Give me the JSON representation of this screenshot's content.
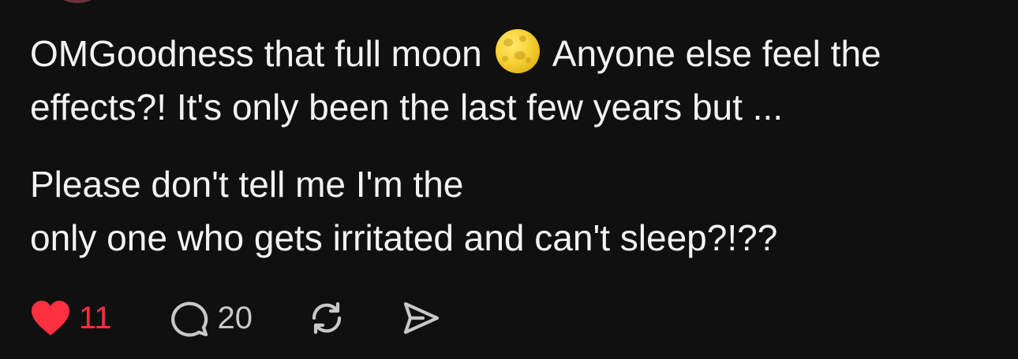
{
  "post": {
    "paragraph1": {
      "line1_before": "OMGoodness that full moon",
      "emoji": "full-moon-emoji",
      "line1_after": "Anyone else feel the",
      "line2": "effects?! It's only been the last few years but ..."
    },
    "paragraph2": {
      "line1": "Please don't tell me I'm the",
      "line2": "only one who gets irritated and can't sleep?!??"
    }
  },
  "actions": {
    "likes": "11",
    "comments": "20",
    "icons": {
      "like": "heart-icon",
      "comment": "comment-bubble-icon",
      "repost": "repost-icon",
      "share": "share-send-icon"
    },
    "colors": {
      "liked": "#ff3040",
      "icon": "#c8c8c8"
    }
  }
}
